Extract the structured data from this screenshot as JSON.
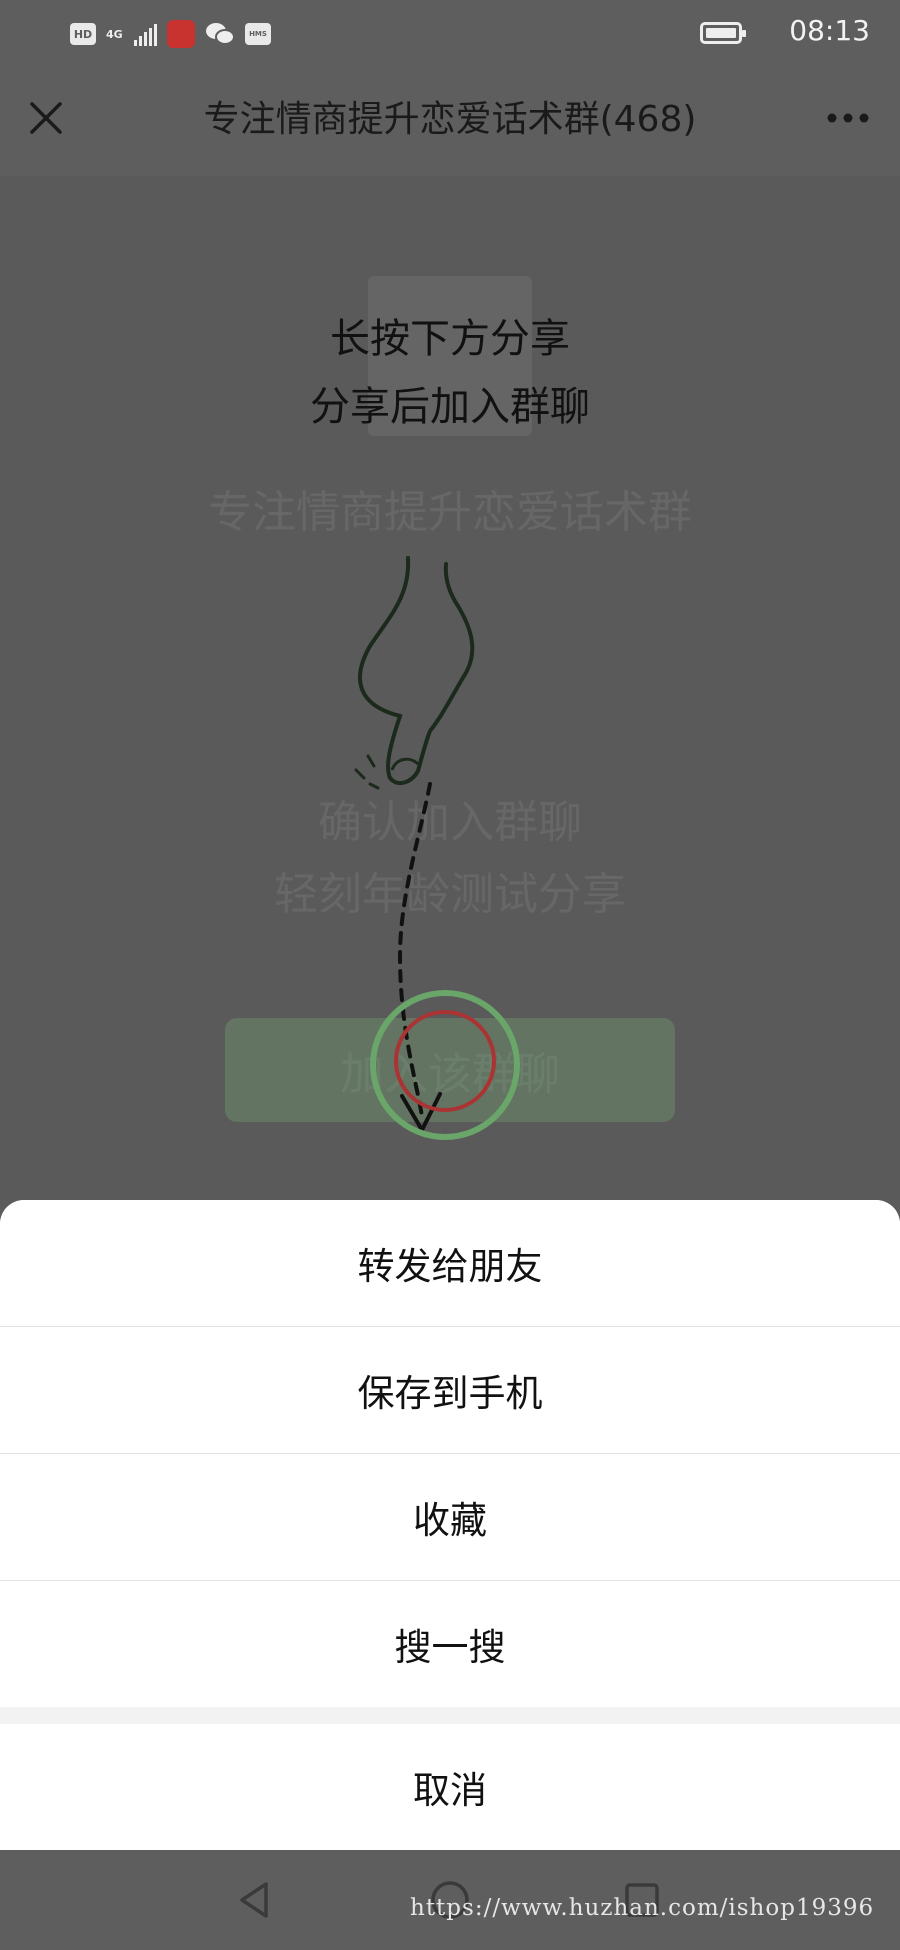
{
  "status_bar": {
    "hd_badge": "HD",
    "network": "4G",
    "hms_badge": "HMS",
    "battery_level": 1.0,
    "time": "08:13",
    "icons": [
      "hd-badge-icon",
      "signal-icon",
      "app-red-icon",
      "wechat-icon",
      "hms-icon",
      "battery-icon"
    ]
  },
  "header": {
    "title": "专注情商提升恋爱话术群(468)",
    "close_icon": "close-icon",
    "more_icon": "more-dots-icon"
  },
  "background_page": {
    "group_name": "专注情商提升恋爱话术群",
    "confirm_line1": "确认加入群聊",
    "confirm_line2": "轻刻年龄测试分享",
    "join_button": "加入该群聊"
  },
  "overlay_instructions": {
    "line1": "长按下方分享",
    "line2": "分享后加入群聊"
  },
  "action_sheet": {
    "options": [
      "转发给朋友",
      "保存到手机",
      "收藏",
      "搜一搜"
    ],
    "cancel": "取消"
  },
  "nav_bar": {
    "icons": [
      "back-triangle-icon",
      "home-circle-icon",
      "recents-square-icon"
    ]
  },
  "watermark": "https://www.huzhan.com/ishop19396",
  "colors": {
    "dim_overlay": "#5c5c5c",
    "sheet_bg": "#ffffff",
    "accent_green": "#6aa56a"
  }
}
